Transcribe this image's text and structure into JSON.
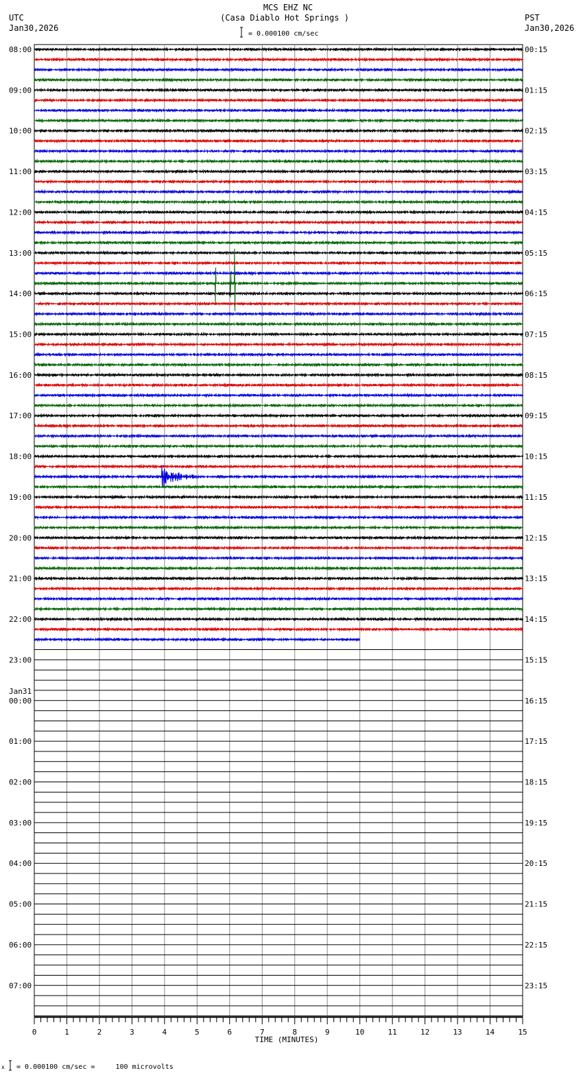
{
  "header": {
    "title": "MCS EHZ NC",
    "subtitle": "(Casa Diablo Hot Springs )",
    "left_tz": "UTC",
    "left_date": "Jan30,2026",
    "right_tz": "PST",
    "right_date": "Jan30,2026",
    "scale_text": "= 0.000100 cm/sec"
  },
  "footer": {
    "scale_text": "= 0.000100 cm/sec =     100 microvolts",
    "prefix": "x"
  },
  "chart_data": {
    "type": "helicorder",
    "xlabel": "TIME (MINUTES)",
    "xlim": [
      0,
      15
    ],
    "x_ticks": [
      "0",
      "1",
      "2",
      "3",
      "4",
      "5",
      "6",
      "7",
      "8",
      "9",
      "10",
      "11",
      "12",
      "13",
      "14",
      "15"
    ],
    "minor_ticks_per_minute": 4,
    "traces_per_hour": 4,
    "total_traces": 96,
    "trace_colors": [
      "#000000",
      "#dd0000",
      "#0000dd",
      "#006400"
    ],
    "recorded_traces": 59,
    "last_trace_end_minute": 10,
    "left_labels": [
      {
        "row": 0,
        "text": "08:00"
      },
      {
        "row": 4,
        "text": "09:00"
      },
      {
        "row": 8,
        "text": "10:00"
      },
      {
        "row": 12,
        "text": "11:00"
      },
      {
        "row": 16,
        "text": "12:00"
      },
      {
        "row": 20,
        "text": "13:00"
      },
      {
        "row": 24,
        "text": "14:00"
      },
      {
        "row": 28,
        "text": "15:00"
      },
      {
        "row": 32,
        "text": "16:00"
      },
      {
        "row": 36,
        "text": "17:00"
      },
      {
        "row": 40,
        "text": "18:00"
      },
      {
        "row": 44,
        "text": "19:00"
      },
      {
        "row": 48,
        "text": "20:00"
      },
      {
        "row": 52,
        "text": "21:00"
      },
      {
        "row": 56,
        "text": "22:00"
      },
      {
        "row": 60,
        "text": "23:00"
      },
      {
        "row": 64,
        "text": "00:00",
        "date": "Jan31"
      },
      {
        "row": 68,
        "text": "01:00"
      },
      {
        "row": 72,
        "text": "02:00"
      },
      {
        "row": 76,
        "text": "03:00"
      },
      {
        "row": 80,
        "text": "04:00"
      },
      {
        "row": 84,
        "text": "05:00"
      },
      {
        "row": 88,
        "text": "06:00"
      },
      {
        "row": 92,
        "text": "07:00"
      }
    ],
    "right_labels": [
      "00:15",
      "01:15",
      "02:15",
      "03:15",
      "04:15",
      "05:15",
      "06:15",
      "07:15",
      "08:15",
      "09:15",
      "10:15",
      "11:15",
      "12:15",
      "13:15",
      "14:15",
      "15:15",
      "16:15",
      "17:15",
      "18:15",
      "19:15",
      "20:15",
      "21:15",
      "22:15",
      "23:15"
    ],
    "events": [
      {
        "row": 23,
        "start_min": 5.5,
        "end_min": 6.3,
        "amplitude": 5,
        "kind": "spikes"
      },
      {
        "row": 42,
        "start_min": 3.9,
        "end_min": 5.6,
        "amplitude": 1.2,
        "kind": "quake"
      }
    ]
  }
}
